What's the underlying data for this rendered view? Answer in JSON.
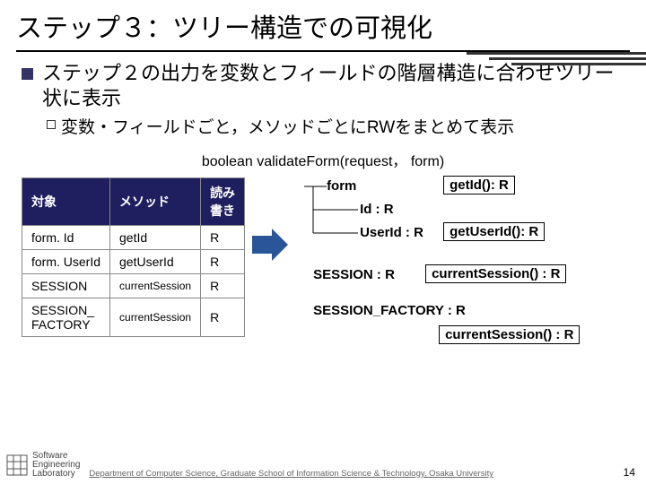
{
  "title": "ステップ３：ツリー構造での可視化",
  "bullets": {
    "l1": "ステップ２の出力を変数とフィールドの階層構造に合わせツリー状に表示",
    "l2": "変数・フィールドごと，メソッドごとにRWをまとめて表示"
  },
  "code": "boolean validateForm(request， form)",
  "table": {
    "headers": {
      "target": "対象",
      "method": "メソッド",
      "rw": "読み\n書き"
    },
    "rows": [
      {
        "target": "form. Id",
        "method": "getId",
        "rw": "R"
      },
      {
        "target": "form. UserId",
        "method": "getUserId",
        "rw": "R"
      },
      {
        "target": "SESSION",
        "method": "currentSession",
        "rw": "R"
      },
      {
        "target": "SESSION_\nFACTORY",
        "method": "currentSession",
        "rw": "R"
      }
    ]
  },
  "tree": {
    "root": "form",
    "id": "Id : R",
    "getid": "getId(): R",
    "userid": "UserId : R",
    "getuserid": "getUserId(): R",
    "session": "SESSION : R",
    "cursession1": "currentSession() : R",
    "sessionfact": "SESSION_FACTORY : R",
    "cursession2": "currentSession() : R"
  },
  "footer": {
    "logo1": "Software",
    "logo2": "Engineering",
    "logo3": "Laboratory",
    "dept": "Department of Computer Science, Graduate School of Information Science & Technology, Osaka University",
    "page": "14"
  }
}
